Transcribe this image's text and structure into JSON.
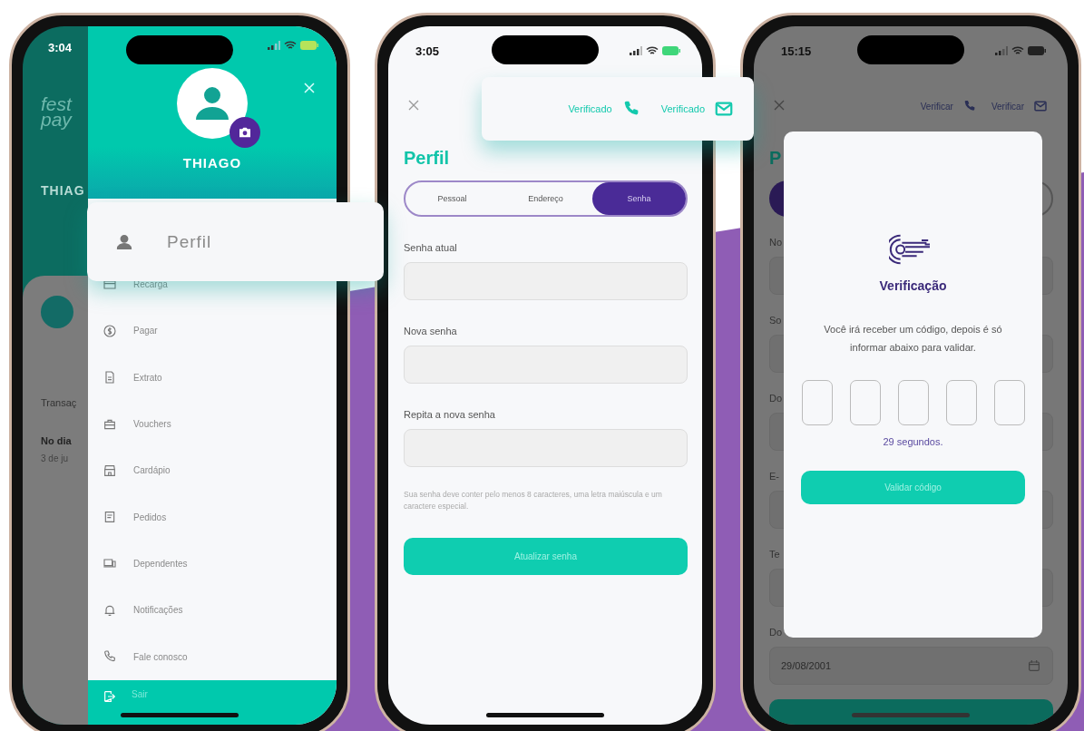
{
  "menu_screen": {
    "status_time": "3:04",
    "logo": [
      "fest",
      "pay"
    ],
    "backdrop": {
      "user_name": "THIAG",
      "section_title": "Transaç",
      "transaction_title": "No dia",
      "transaction_date": "3 de ju"
    },
    "drawer": {
      "user_name": "THIAGO",
      "items": [
        {
          "label": "Perfil",
          "selected": true
        },
        {
          "label": "Recarga",
          "selected": false
        },
        {
          "label": "Pagar",
          "selected": false
        },
        {
          "label": "Extrato",
          "selected": false
        },
        {
          "label": "Vouchers",
          "selected": false
        },
        {
          "label": "Cardápio",
          "selected": false
        },
        {
          "label": "Pedidos",
          "selected": false
        },
        {
          "label": "Dependentes",
          "selected": false
        },
        {
          "label": "Notificações",
          "selected": false
        },
        {
          "label": "Fale conosco",
          "selected": false
        }
      ],
      "logout": "Sair"
    }
  },
  "password_screen": {
    "status_time": "3:05",
    "verifications": [
      {
        "label": "Verificado",
        "kind": "phone"
      },
      {
        "label": "Verificado",
        "kind": "email"
      }
    ],
    "title": "Perfil",
    "tabs": [
      {
        "label": "Pessoal",
        "selected": false
      },
      {
        "label": "Endereço",
        "selected": false
      },
      {
        "label": "Senha",
        "selected": true
      }
    ],
    "fields": [
      {
        "label": "Senha atual"
      },
      {
        "label": "Nova senha"
      },
      {
        "label": "Repita a nova senha"
      }
    ],
    "hint": "Sua senha deve conter pelo menos 8 caracteres, uma letra maiúscula e um caractere especial.",
    "button": "Atualizar senha"
  },
  "verification_screen": {
    "status_time": "15:15",
    "verifications": [
      {
        "label": "Verificar",
        "kind": "phone"
      },
      {
        "label": "Verificar",
        "kind": "email"
      }
    ],
    "title": "P",
    "fields": [
      {
        "label": "No",
        "kind": "text"
      },
      {
        "label": "So",
        "kind": "text"
      },
      {
        "label": "Do",
        "kind": "text"
      },
      {
        "label": "E-",
        "kind": "text"
      },
      {
        "label": "Te",
        "kind": "text"
      },
      {
        "label": "Do",
        "kind": "date",
        "value": "29/08/2001"
      }
    ],
    "dialog": {
      "title": "Verificação",
      "message": "Você irá receber um código, depois é só informar abaixo para validar.",
      "timer": "29 segundos.",
      "button": "Validar código"
    }
  }
}
